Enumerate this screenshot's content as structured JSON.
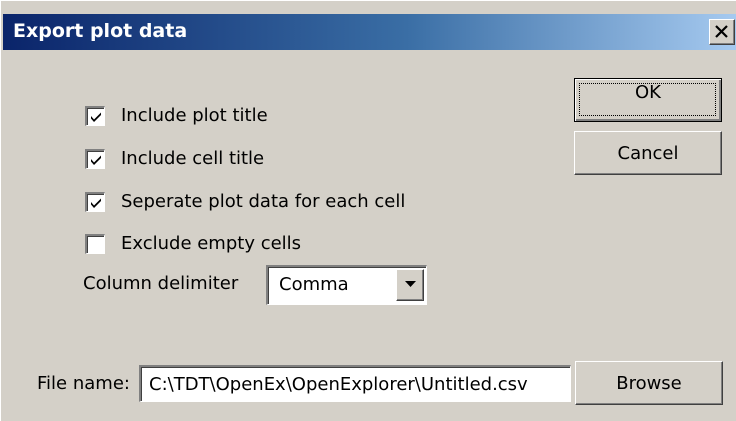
{
  "window": {
    "title": "Export plot data",
    "close_icon": "close-icon"
  },
  "options": [
    {
      "label": "Include plot title",
      "checked": true
    },
    {
      "label": "Include cell title",
      "checked": true
    },
    {
      "label": "Seperate plot data for each cell",
      "checked": true
    },
    {
      "label": "Exclude empty cells",
      "checked": false
    }
  ],
  "delimiter": {
    "label": "Column delimiter",
    "value": "Comma",
    "arrow_icon": "chevron-down-icon"
  },
  "buttons": {
    "ok": "OK",
    "cancel": "Cancel",
    "browse": "Browse"
  },
  "file": {
    "label": "File name:",
    "value": "C:\\TDT\\OpenEx\\OpenExplorer\\Untitled.csv"
  },
  "colors": {
    "face": "#d4d0c8",
    "title_start": "#0a246a",
    "title_end": "#a6caf0",
    "title_text": "#ffffff"
  }
}
